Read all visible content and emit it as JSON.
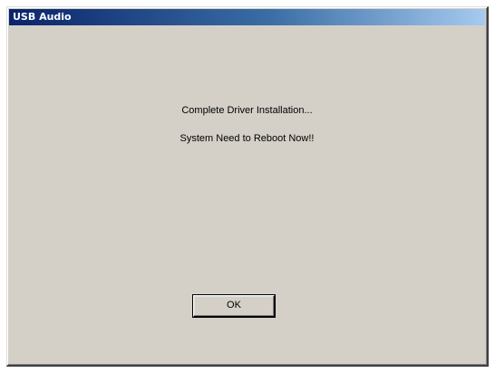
{
  "window": {
    "title": "USB Audio"
  },
  "message": {
    "line1": "Complete Driver Installation...",
    "line2": "System Need to Reboot Now!!"
  },
  "buttons": {
    "ok_label": "OK"
  },
  "colors": {
    "titlebar_start": "#0a246a",
    "titlebar_end": "#a6caf0",
    "dialog_background": "#d4d0c8"
  }
}
